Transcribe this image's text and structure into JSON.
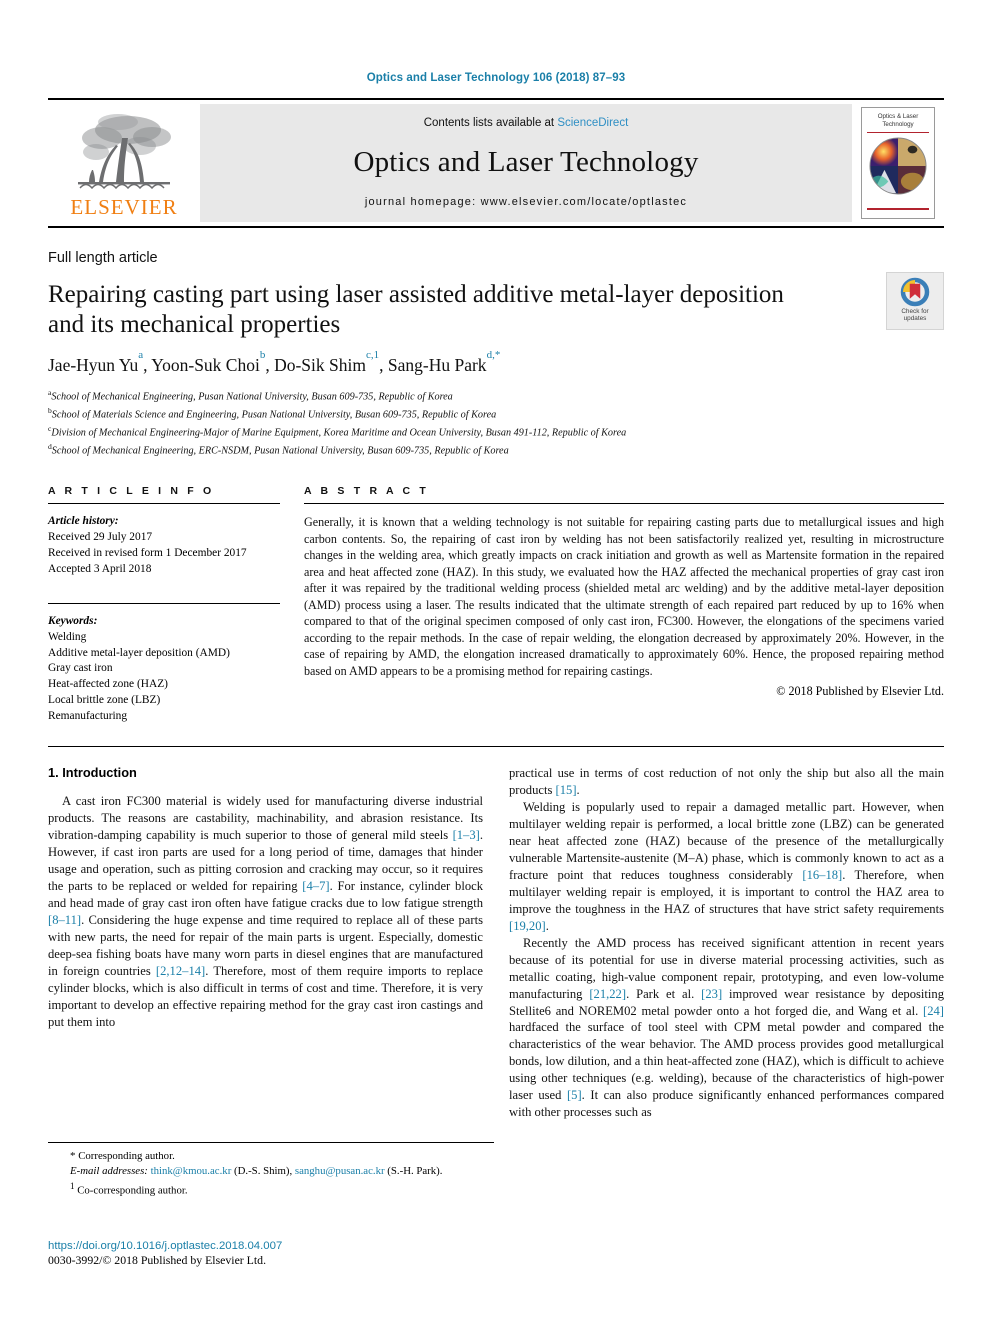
{
  "running_head": "Optics and Laser Technology 106 (2018) 87–93",
  "masthead": {
    "publisher": "ELSEVIER",
    "contents_prefix": "Contents lists available at ",
    "contents_link": "ScienceDirect",
    "journal_name": "Optics and Laser Technology",
    "homepage": "journal homepage: www.elsevier.com/locate/optlastec",
    "cover_title_line1": "Optics & Laser",
    "cover_title_line2": "Technology"
  },
  "crossmark": {
    "line1": "Check for",
    "line2": "updates"
  },
  "article": {
    "kicker": "Full length article",
    "title": "Repairing casting part using laser assisted additive metal-layer deposition and its mechanical properties",
    "authors": [
      {
        "name": "Jae-Hyun Yu",
        "sup": "a"
      },
      {
        "name": "Yoon-Suk Choi",
        "sup": "b"
      },
      {
        "name": "Do-Sik Shim",
        "sup": "c,1"
      },
      {
        "name": "Sang-Hu Park",
        "sup": "d,*"
      }
    ],
    "affiliations": [
      {
        "label": "a",
        "text": "School of Mechanical Engineering, Pusan National University, Busan 609-735, Republic of Korea"
      },
      {
        "label": "b",
        "text": "School of Materials Science and Engineering, Pusan National University, Busan 609-735, Republic of Korea"
      },
      {
        "label": "c",
        "text": "Division of Mechanical Engineering-Major of Marine Equipment, Korea Maritime and Ocean University, Busan 491-112, Republic of Korea"
      },
      {
        "label": "d",
        "text": "School of Mechanical Engineering, ERC-NSDM, Pusan National University, Busan 609-735, Republic of Korea"
      }
    ]
  },
  "article_info": {
    "heading": "A R T I C L E   I N F O",
    "history_label": "Article history:",
    "history": [
      "Received 29 July 2017",
      "Received in revised form 1 December 2017",
      "Accepted 3 April 2018"
    ],
    "keywords_label": "Keywords:",
    "keywords": [
      "Welding",
      "Additive metal-layer deposition (AMD)",
      "Gray cast iron",
      "Heat-affected zone (HAZ)",
      "Local brittle zone (LBZ)",
      "Remanufacturing"
    ]
  },
  "abstract": {
    "heading": "A B S T R A C T",
    "text": "Generally, it is known that a welding technology is not suitable for repairing casting parts due to metallurgical issues and high carbon contents. So, the repairing of cast iron by welding has not been satisfactorily realized yet, resulting in microstructure changes in the welding area, which greatly impacts on crack initiation and growth as well as Martensite formation in the repaired area and heat affected zone (HAZ). In this study, we evaluated how the HAZ affected the mechanical properties of gray cast iron after it was repaired by the traditional welding process (shielded metal arc welding) and by the additive metal-layer deposition (AMD) process using a laser. The results indicated that the ultimate strength of each repaired part reduced by up to 16% when compared to that of the original specimen composed of only cast iron, FC300. However, the elongations of the specimens varied according to the repair methods. In the case of repair welding, the elongation decreased by approximately 20%. However, in the case of repairing by AMD, the elongation increased dramatically to approximately 60%. Hence, the proposed repairing method based on AMD appears to be a promising method for repairing castings.",
    "copyright": "© 2018 Published by Elsevier Ltd."
  },
  "body": {
    "section_title": "1. Introduction",
    "left_paragraphs": [
      "A cast iron FC300 material is widely used for manufacturing diverse industrial products. The reasons are castability, machinability, and abrasion resistance. Its vibration-damping capability is much superior to those of general mild steels [1–3]. However, if cast iron parts are used for a long period of time, damages that hinder usage and operation, such as pitting corrosion and cracking may occur, so it requires the parts to be replaced or welded for repairing [4–7]. For instance, cylinder block and head made of gray cast iron often have fatigue cracks due to low fatigue strength [8–11]. Considering the huge expense and time required to replace all of these parts with new parts, the need for repair of the main parts is urgent. Especially, domestic deep-sea fishing boats have many worn parts in diesel engines that are manufactured in foreign countries [2,12–14]. Therefore, most of them require imports to replace cylinder blocks, which is also difficult in terms of cost and time. Therefore, it is very important to develop an effective repairing method for the gray cast iron castings and put them into"
    ],
    "right_paragraphs": [
      "practical use in terms of cost reduction of not only the ship but also all the main products [15].",
      "Welding is popularly used to repair a damaged metallic part. However, when multilayer welding repair is performed, a local brittle zone (LBZ) can be generated near heat affected zone (HAZ) because of the presence of the metallurgically vulnerable Martensite-austenite (M–A) phase, which is commonly known to act as a fracture point that reduces toughness considerably [16–18]. Therefore, when multilayer welding repair is employed, it is important to control the HAZ area to improve the toughness in the HAZ of structures that have strict safety requirements [19,20].",
      "Recently the AMD process has received significant attention in recent years because of its potential for use in diverse material processing activities, such as metallic coating, high-value component repair, prototyping, and even low-volume manufacturing [21,22]. Park et al. [23] improved wear resistance by depositing Stellite6 and NOREM02 metal powder onto a hot forged die, and Wang et al. [24] hardfaced the surface of tool steel with CPM metal powder and compared the characteristics of the wear behavior. The AMD process provides good metallurgical bonds, low dilution, and a thin heat-affected zone (HAZ), which is difficult to achieve using other techniques (e.g. welding), because of the characteristics of high-power laser used [5]. It can also produce significantly enhanced performances compared with other processes such as"
    ]
  },
  "footnotes": {
    "corresponding": "Corresponding author.",
    "email_label": "E-mail addresses:",
    "email1": "think@kmou.ac.kr",
    "email1_owner": "(D.-S. Shim),",
    "email2": "sanghu@pusan.ac.kr",
    "email2_owner": "(S.-H. Park).",
    "co_corresponding_marker": "1",
    "co_corresponding": "Co-corresponding author.",
    "doi": "https://doi.org/10.1016/j.optlastec.2018.04.007",
    "issn_line": "0030-3992/© 2018 Published by Elsevier Ltd."
  },
  "colors": {
    "link": "#1a7fa8",
    "elsevier_orange": "#f07f13",
    "sciencedirect": "#2f8fc4",
    "cover_red": "#b2232e"
  }
}
